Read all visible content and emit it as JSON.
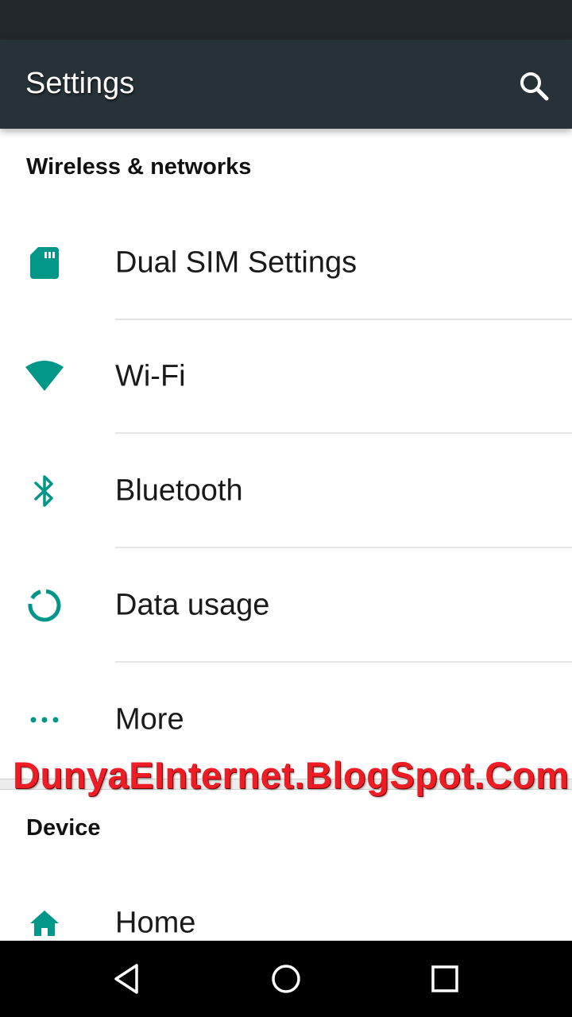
{
  "app_bar": {
    "title": "Settings",
    "search_icon": "search-icon"
  },
  "sections": {
    "wireless": {
      "header": "Wireless & networks",
      "items": [
        {
          "label": "Dual SIM Settings",
          "icon": "sim-card-icon"
        },
        {
          "label": "Wi-Fi",
          "icon": "wifi-icon"
        },
        {
          "label": "Bluetooth",
          "icon": "bluetooth-icon"
        },
        {
          "label": "Data usage",
          "icon": "data-usage-icon"
        },
        {
          "label": "More",
          "icon": "more-dots-icon"
        }
      ]
    },
    "device": {
      "header": "Device",
      "items": [
        {
          "label": "Home",
          "icon": "home-icon"
        }
      ]
    }
  },
  "watermark": "DunyaEInternet.BlogSpot.Com",
  "nav_bar": {
    "back_icon": "back-icon",
    "home_icon": "home-circle-icon",
    "recents_icon": "recents-icon"
  },
  "colors": {
    "status_bar": "#21272b",
    "app_bar": "#263238",
    "accent": "#009688",
    "watermark": "#ee1c25"
  }
}
